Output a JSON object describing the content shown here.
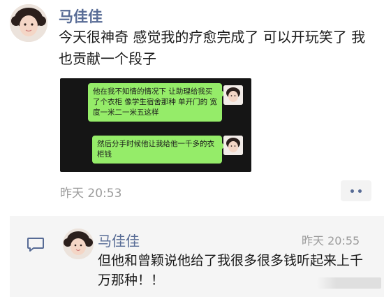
{
  "post": {
    "author": "马佳佳",
    "text": "今天很神奇 感觉我的疗愈完成了 可以开玩笑了 我也贡献一个段子",
    "time": "昨天 20:53"
  },
  "chat_screenshot": {
    "messages": [
      "他在我不知情的情况下 让助理给我买了个衣柜 像学生宿舍那种 单开门的 宽度一米二一米五这样",
      "然后分手时候他让我给他一千多的衣柜钱"
    ]
  },
  "comment": {
    "author": "马佳佳",
    "time": "昨天 20:55",
    "text": "但他和曾颖说他给了我很多很多钱听起来上千万那种！！"
  },
  "icons": {
    "more": "more-dots-icon",
    "comment": "comment-bubble-icon"
  },
  "colors": {
    "link_blue": "#576b95",
    "bubble_green": "#95ec69",
    "chat_bg": "#151515",
    "comment_bg": "#f5f5f5"
  }
}
